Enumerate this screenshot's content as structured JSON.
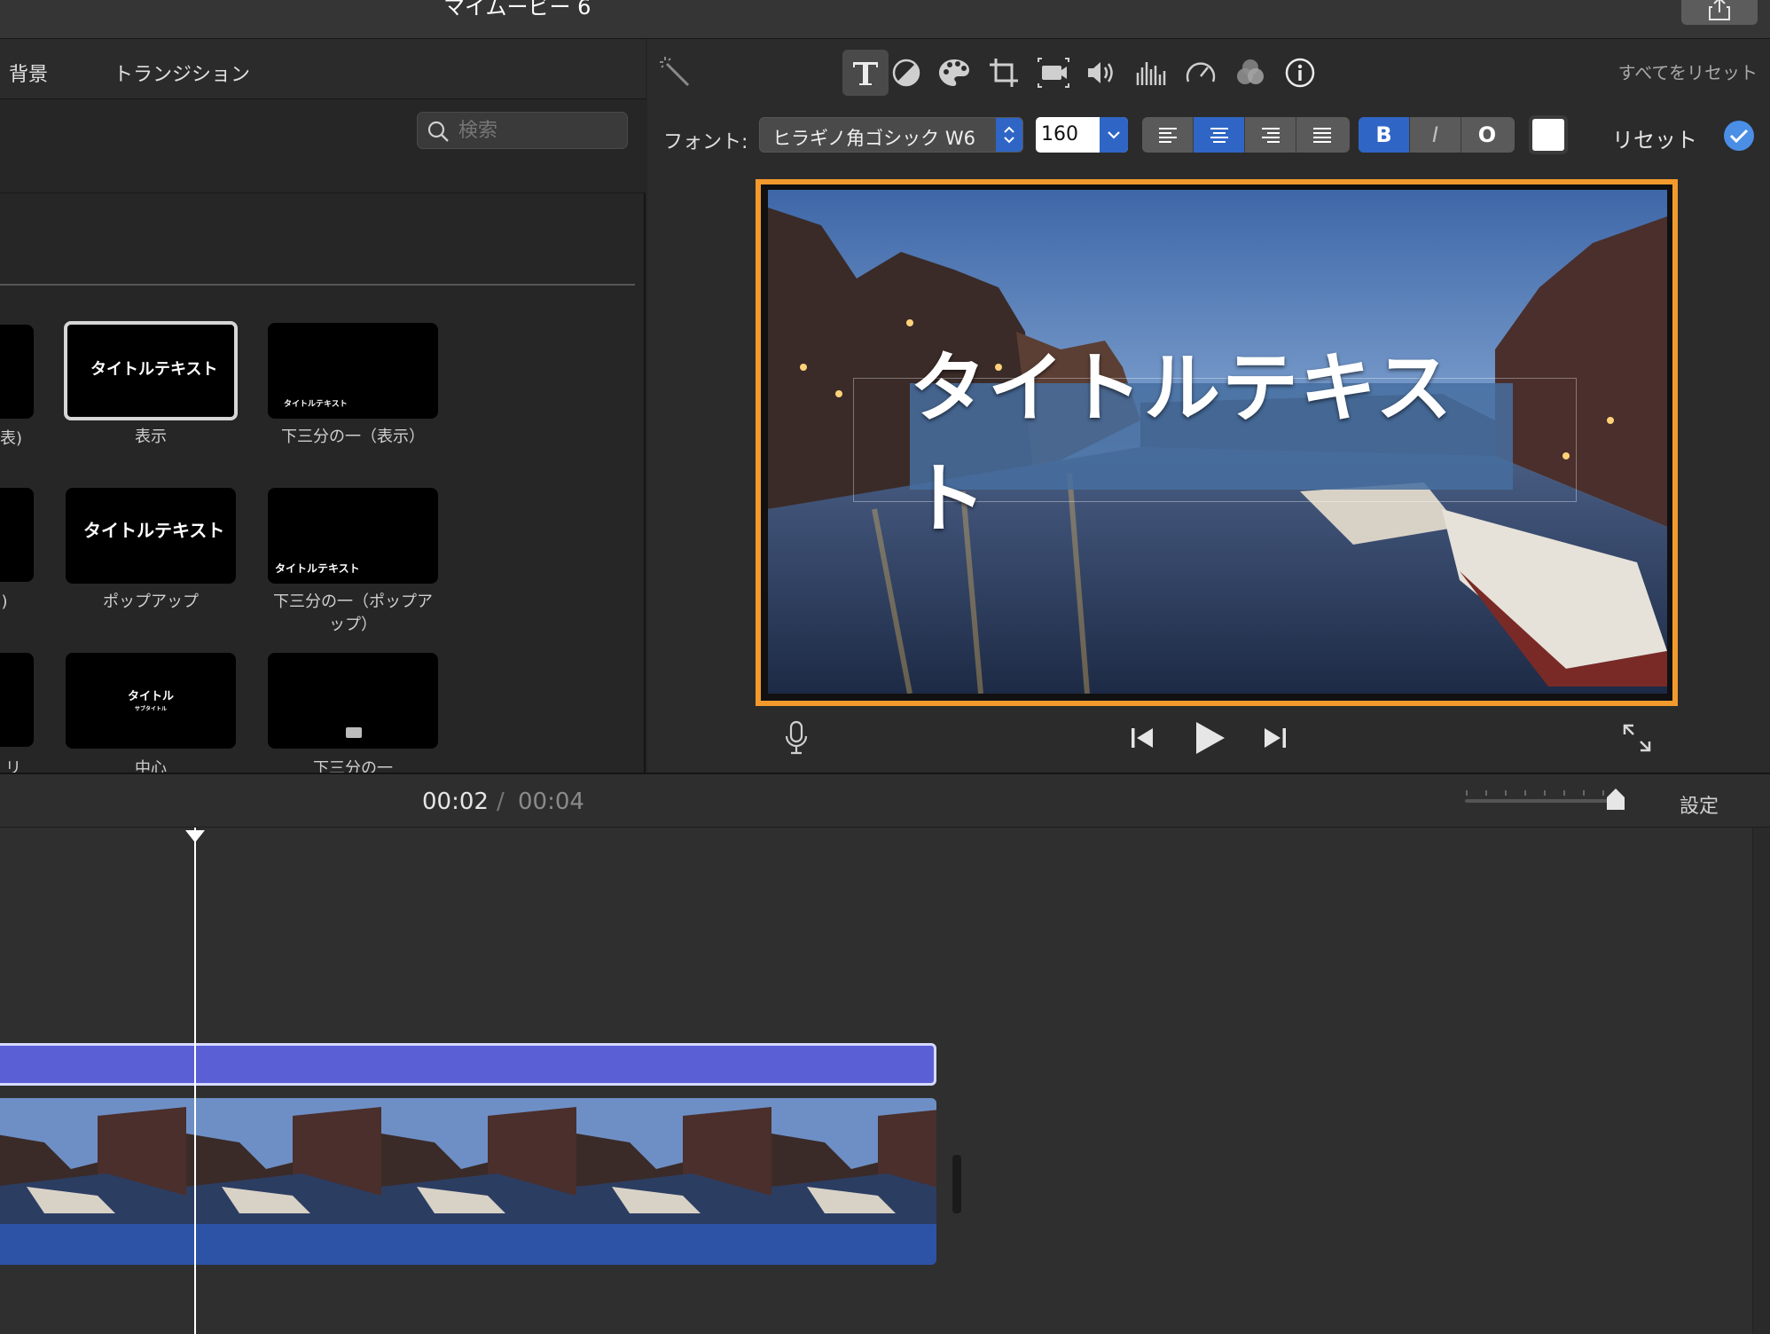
{
  "window": {
    "title": "マイムービー 6"
  },
  "browser": {
    "tabs": [
      "背景",
      "トランジション"
    ],
    "search": {
      "placeholder": "検索"
    },
    "titles": [
      {
        "label": "表示",
        "preview_text": "タイトルテキスト"
      },
      {
        "label": "下三分の一（表示）",
        "preview_text": "タイトルテキスト"
      },
      {
        "label": "ポップアップ",
        "preview_text": "タイトルテキスト"
      },
      {
        "label": "下三分の一（ポップアップ）",
        "preview_text": "タイトルテキスト"
      },
      {
        "label": "中心",
        "preview_text": "タイトル",
        "preview_sub": "サブタイトル"
      },
      {
        "label": "下三分の一",
        "preview_text": ""
      }
    ],
    "partial_labels": [
      "表)",
      ")",
      "リズ"
    ]
  },
  "adjust_toolbar": {
    "tools": [
      "magic-wand",
      "title",
      "color-balance",
      "color-correction",
      "crop",
      "stabilization",
      "volume",
      "equalizer",
      "speed",
      "filter",
      "info"
    ],
    "selected": "title",
    "reset_all": "すべてをリセット"
  },
  "font_bar": {
    "font_label": "フォント:",
    "font_name": "ヒラギノ角ゴシック W6",
    "size": "160",
    "alignment_selected": "center",
    "bold": "B",
    "italic": "I",
    "outline": "O",
    "text_color": "#ffffff",
    "reset": "リセット"
  },
  "viewer": {
    "title_text": "タイトルテキスト"
  },
  "timeline": {
    "current_time": "00:02",
    "separator": "/",
    "total_time": "00:04",
    "settings": "設定"
  },
  "colors": {
    "accent": "#f39a2c",
    "selection_blue": "#2f66c6",
    "title_clip": "#5a5fd6",
    "video_clip": "#2d53a6"
  }
}
